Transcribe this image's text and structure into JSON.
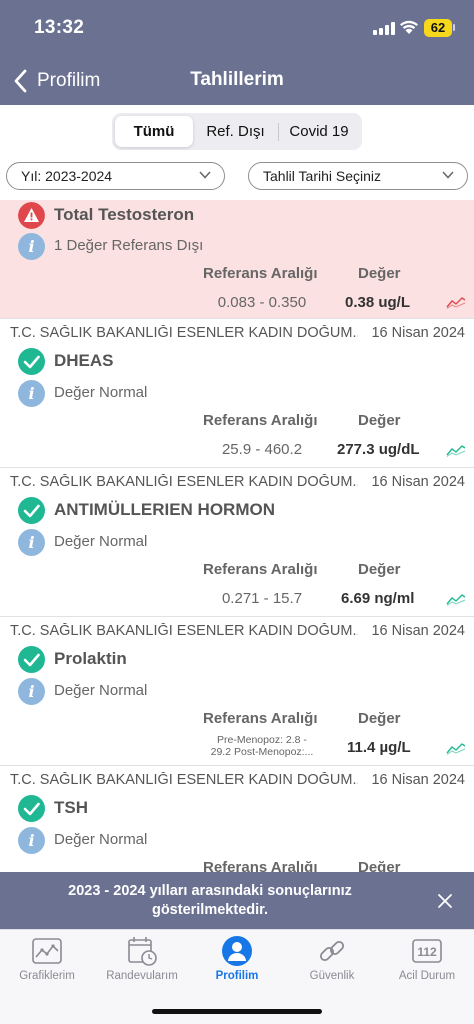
{
  "status_bar": {
    "time": "13:32",
    "battery": "62"
  },
  "nav": {
    "back_label": "Profilim",
    "title": "Tahlillerim"
  },
  "segments": [
    "Tümü",
    "Ref. Dışı",
    "Covid 19"
  ],
  "filters": {
    "year": "Yıl: 2023-2024",
    "date": "Tahlil Tarihi Seçiniz"
  },
  "col_ref_header": "Referans Aralığı",
  "col_val_header": "Değer",
  "results": [
    {
      "hospital": "",
      "date": "",
      "name": "Total Testosteron",
      "status": "1 Değer Referans Dışı",
      "ref": "0.083 - 0.350",
      "value": "0.38 ug/L",
      "abnormal": true
    },
    {
      "hospital": "T.C. SAĞLIK BAKANLIĞI ESENLER KADIN DOĞUM...",
      "date": "16 Nisan 2024",
      "name": "DHEAS",
      "status": "Değer Normal",
      "ref": "25.9 - 460.2",
      "value": "277.3 ug/dL",
      "abnormal": false
    },
    {
      "hospital": "T.C. SAĞLIK BAKANLIĞI ESENLER KADIN DOĞUM...",
      "date": "16 Nisan 2024",
      "name": "ANTIMÜLLERIEN HORMON",
      "status": "Değer Normal",
      "ref": "0.271 - 15.7",
      "value": "6.69 ng/ml",
      "abnormal": false
    },
    {
      "hospital": "T.C. SAĞLIK BAKANLIĞI ESENLER KADIN DOĞUM...",
      "date": "16 Nisan 2024",
      "name": "Prolaktin",
      "status": "Değer Normal",
      "ref_line1": "Pre-Menopoz:   2.8 -",
      "ref_line2": "29.2  Post-Menopoz:...",
      "value": "11.4 µg/L",
      "abnormal": false
    },
    {
      "hospital": "T.C. SAĞLIK BAKANLIĞI ESENLER KADIN DOĞUM...",
      "date": "16 Nisan 2024",
      "name": "TSH",
      "status": "Değer Normal",
      "ref": "",
      "value": "",
      "abnormal": false
    }
  ],
  "toast": {
    "text": "2023 - 2024 yılları arasındaki sonuçlarınız gösterilmektedir."
  },
  "tabs": [
    {
      "label": "Grafiklerim",
      "icon": "chart-icon"
    },
    {
      "label": "Randevularım",
      "icon": "calendar-clock-icon"
    },
    {
      "label": "Profilim",
      "icon": "person-icon"
    },
    {
      "label": "Güvenlik",
      "icon": "link-icon"
    },
    {
      "label": "Acil Durum",
      "icon": "emergency-112-icon",
      "badge": "112"
    }
  ],
  "colors": {
    "header": "#6b7191",
    "ok": "#1fb893",
    "warn": "#e0474c",
    "active_tab": "#1777e6",
    "abnormal_bg": "#fbe1e2"
  }
}
